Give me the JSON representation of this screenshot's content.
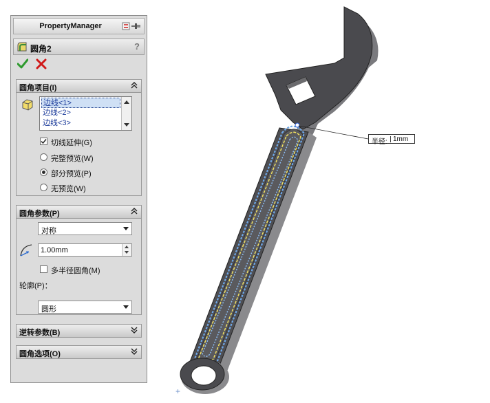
{
  "header": {
    "title": "PropertyManager",
    "pin_icon": "pushpin-icon"
  },
  "feature": {
    "name": "圆角2",
    "help": "?"
  },
  "actions": {
    "ok_icon": "green-checkmark-icon",
    "cancel_icon": "red-x-icon"
  },
  "fillet_items": {
    "title": "圆角项目(I)",
    "edges": [
      "边线<1>",
      "边线<2>",
      "边线<3>"
    ],
    "selected_index": 0,
    "tangent_propagation": {
      "label": "切线延伸(G)",
      "checked": true
    },
    "preview_options": [
      {
        "label": "完整预览(W)",
        "selected": false
      },
      {
        "label": "部分预览(P)",
        "selected": true
      },
      {
        "label": "无预览(W)",
        "selected": false
      }
    ]
  },
  "fillet_params": {
    "title": "圆角参数(P)",
    "method": "对称",
    "radius": "1.00mm",
    "multi_radius": {
      "label": "多半径圆角(M)",
      "checked": false
    },
    "profile_label": "轮廓(P)：",
    "profile": "圆形"
  },
  "reverse_params": {
    "title": "逆转参数(B)"
  },
  "fillet_options": {
    "title": "圆角选项(O)"
  },
  "viewport": {
    "callout_label": "半径:",
    "callout_value": "1mm"
  },
  "colors": {
    "panel_bg": "#dcdcdc",
    "model_dark": "#4a4a4e",
    "edge_highlight_blue": "#6fa8e8",
    "edge_highlight_yellow": "#f0e060",
    "ok_green": "#2e9a2e",
    "cancel_red": "#d01818"
  }
}
